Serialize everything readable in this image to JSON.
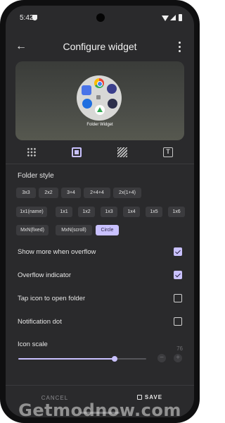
{
  "status_bar": {
    "time": "5:42"
  },
  "app_bar": {
    "title": "Configure widget"
  },
  "preview": {
    "folder_label": "Folder Widget"
  },
  "folder_style": {
    "title": "Folder style",
    "rows": [
      [
        "3x3",
        "2x2",
        "3+4",
        "2+4+4",
        "2x(1+4)"
      ],
      [
        "1x1(name)",
        "1x1",
        "1x2",
        "1x3",
        "1x4",
        "1x5",
        "1x6"
      ],
      [
        "MxN(fixed)",
        "MxN(scroll)",
        "Circle"
      ]
    ],
    "selected": "Circle"
  },
  "settings": [
    {
      "label": "Show more when overflow",
      "checked": true
    },
    {
      "label": "Overflow indicator",
      "checked": true
    },
    {
      "label": "Tap icon to open folder",
      "checked": false
    },
    {
      "label": "Notification dot",
      "checked": false
    }
  ],
  "icon_scale": {
    "label": "Icon scale",
    "value": "76",
    "fraction": 0.75,
    "minus": "−",
    "plus": "+"
  },
  "footer": {
    "cancel": "CANCEL",
    "save": "SAVE"
  },
  "watermark": "Getmodnow.com",
  "colors": {
    "accent": "#c9c1ff",
    "background": "#2a2a2c",
    "chip": "#3b3b3e"
  }
}
